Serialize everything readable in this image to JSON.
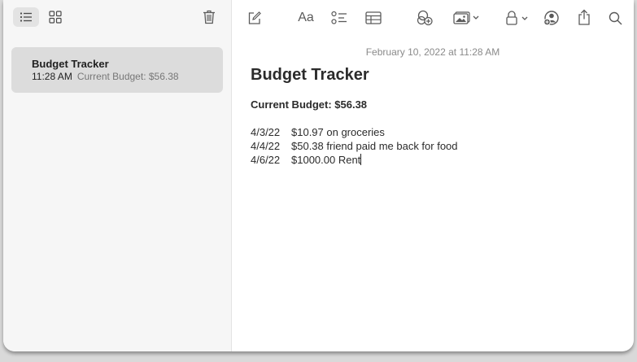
{
  "sidebar": {
    "toolbar": {
      "list_view_icon": "list-icon",
      "gallery_view_icon": "grid-icon",
      "delete_icon": "trash-icon"
    },
    "notes": [
      {
        "title": "Budget Tracker",
        "time": "11:28 AM",
        "preview": "Current Budget: $56.38"
      }
    ]
  },
  "toolbar": {
    "icons": [
      "compose-icon",
      "format-icon",
      "checklist-icon",
      "table-icon",
      "collaborate-icon",
      "media-icon",
      "lock-icon",
      "share-person-icon",
      "share-icon",
      "search-icon"
    ],
    "format_label": "Aa"
  },
  "note": {
    "date": "February 10, 2022 at 11:28 AM",
    "title": "Budget Tracker",
    "subtitle": "Current Budget: $56.38",
    "entries": [
      {
        "date": "4/3/22",
        "text": "$10.97 on groceries"
      },
      {
        "date": "4/4/22",
        "text": "$50.38 friend paid me back for food"
      },
      {
        "date": "4/6/22",
        "text": "$1000.00 Rent"
      }
    ]
  },
  "colors": {
    "selection": "#dcdcdc",
    "sidebar_bg": "#f6f6f6",
    "text": "#2b2b2b"
  }
}
